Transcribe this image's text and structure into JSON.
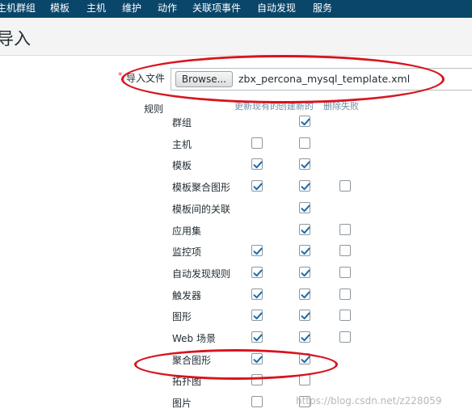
{
  "nav": {
    "items": [
      "主机群组",
      "模板",
      "主机",
      "维护",
      "动作",
      "关联项事件",
      "自动发现",
      "服务"
    ]
  },
  "page": {
    "title": "导入"
  },
  "form": {
    "required_mark": "*",
    "file_label": "导入文件",
    "browse_label": "Browse...",
    "file_name": "zbx_percona_mysql_template.xml",
    "rules_label": "规则",
    "column_headers": [
      "更新现有的",
      "创建新的",
      "删除失败"
    ]
  },
  "rules": [
    {
      "label": "群组",
      "update": null,
      "create": true,
      "delete": null
    },
    {
      "label": "主机",
      "update": false,
      "create": false,
      "delete": null
    },
    {
      "label": "模板",
      "update": true,
      "create": true,
      "delete": null
    },
    {
      "label": "模板聚合图形",
      "update": true,
      "create": true,
      "delete": false
    },
    {
      "label": "模板间的关联",
      "update": null,
      "create": true,
      "delete": null
    },
    {
      "label": "应用集",
      "update": null,
      "create": true,
      "delete": false
    },
    {
      "label": "监控项",
      "update": true,
      "create": true,
      "delete": false
    },
    {
      "label": "自动发现规则",
      "update": true,
      "create": true,
      "delete": false
    },
    {
      "label": "触发器",
      "update": true,
      "create": true,
      "delete": false
    },
    {
      "label": "图形",
      "update": true,
      "create": true,
      "delete": false
    },
    {
      "label": "Web 场景",
      "update": true,
      "create": true,
      "delete": false
    },
    {
      "label": "聚合图形",
      "update": true,
      "create": true,
      "delete": null
    },
    {
      "label": "拓扑图",
      "update": false,
      "create": false,
      "delete": null
    },
    {
      "label": "图片",
      "update": false,
      "create": false,
      "delete": null
    }
  ],
  "watermark": "https://blog.csdn.net/z228059",
  "colors": {
    "nav_bg": "#0a466a",
    "check": "#1c6aa8",
    "annotation": "#d8141e"
  }
}
